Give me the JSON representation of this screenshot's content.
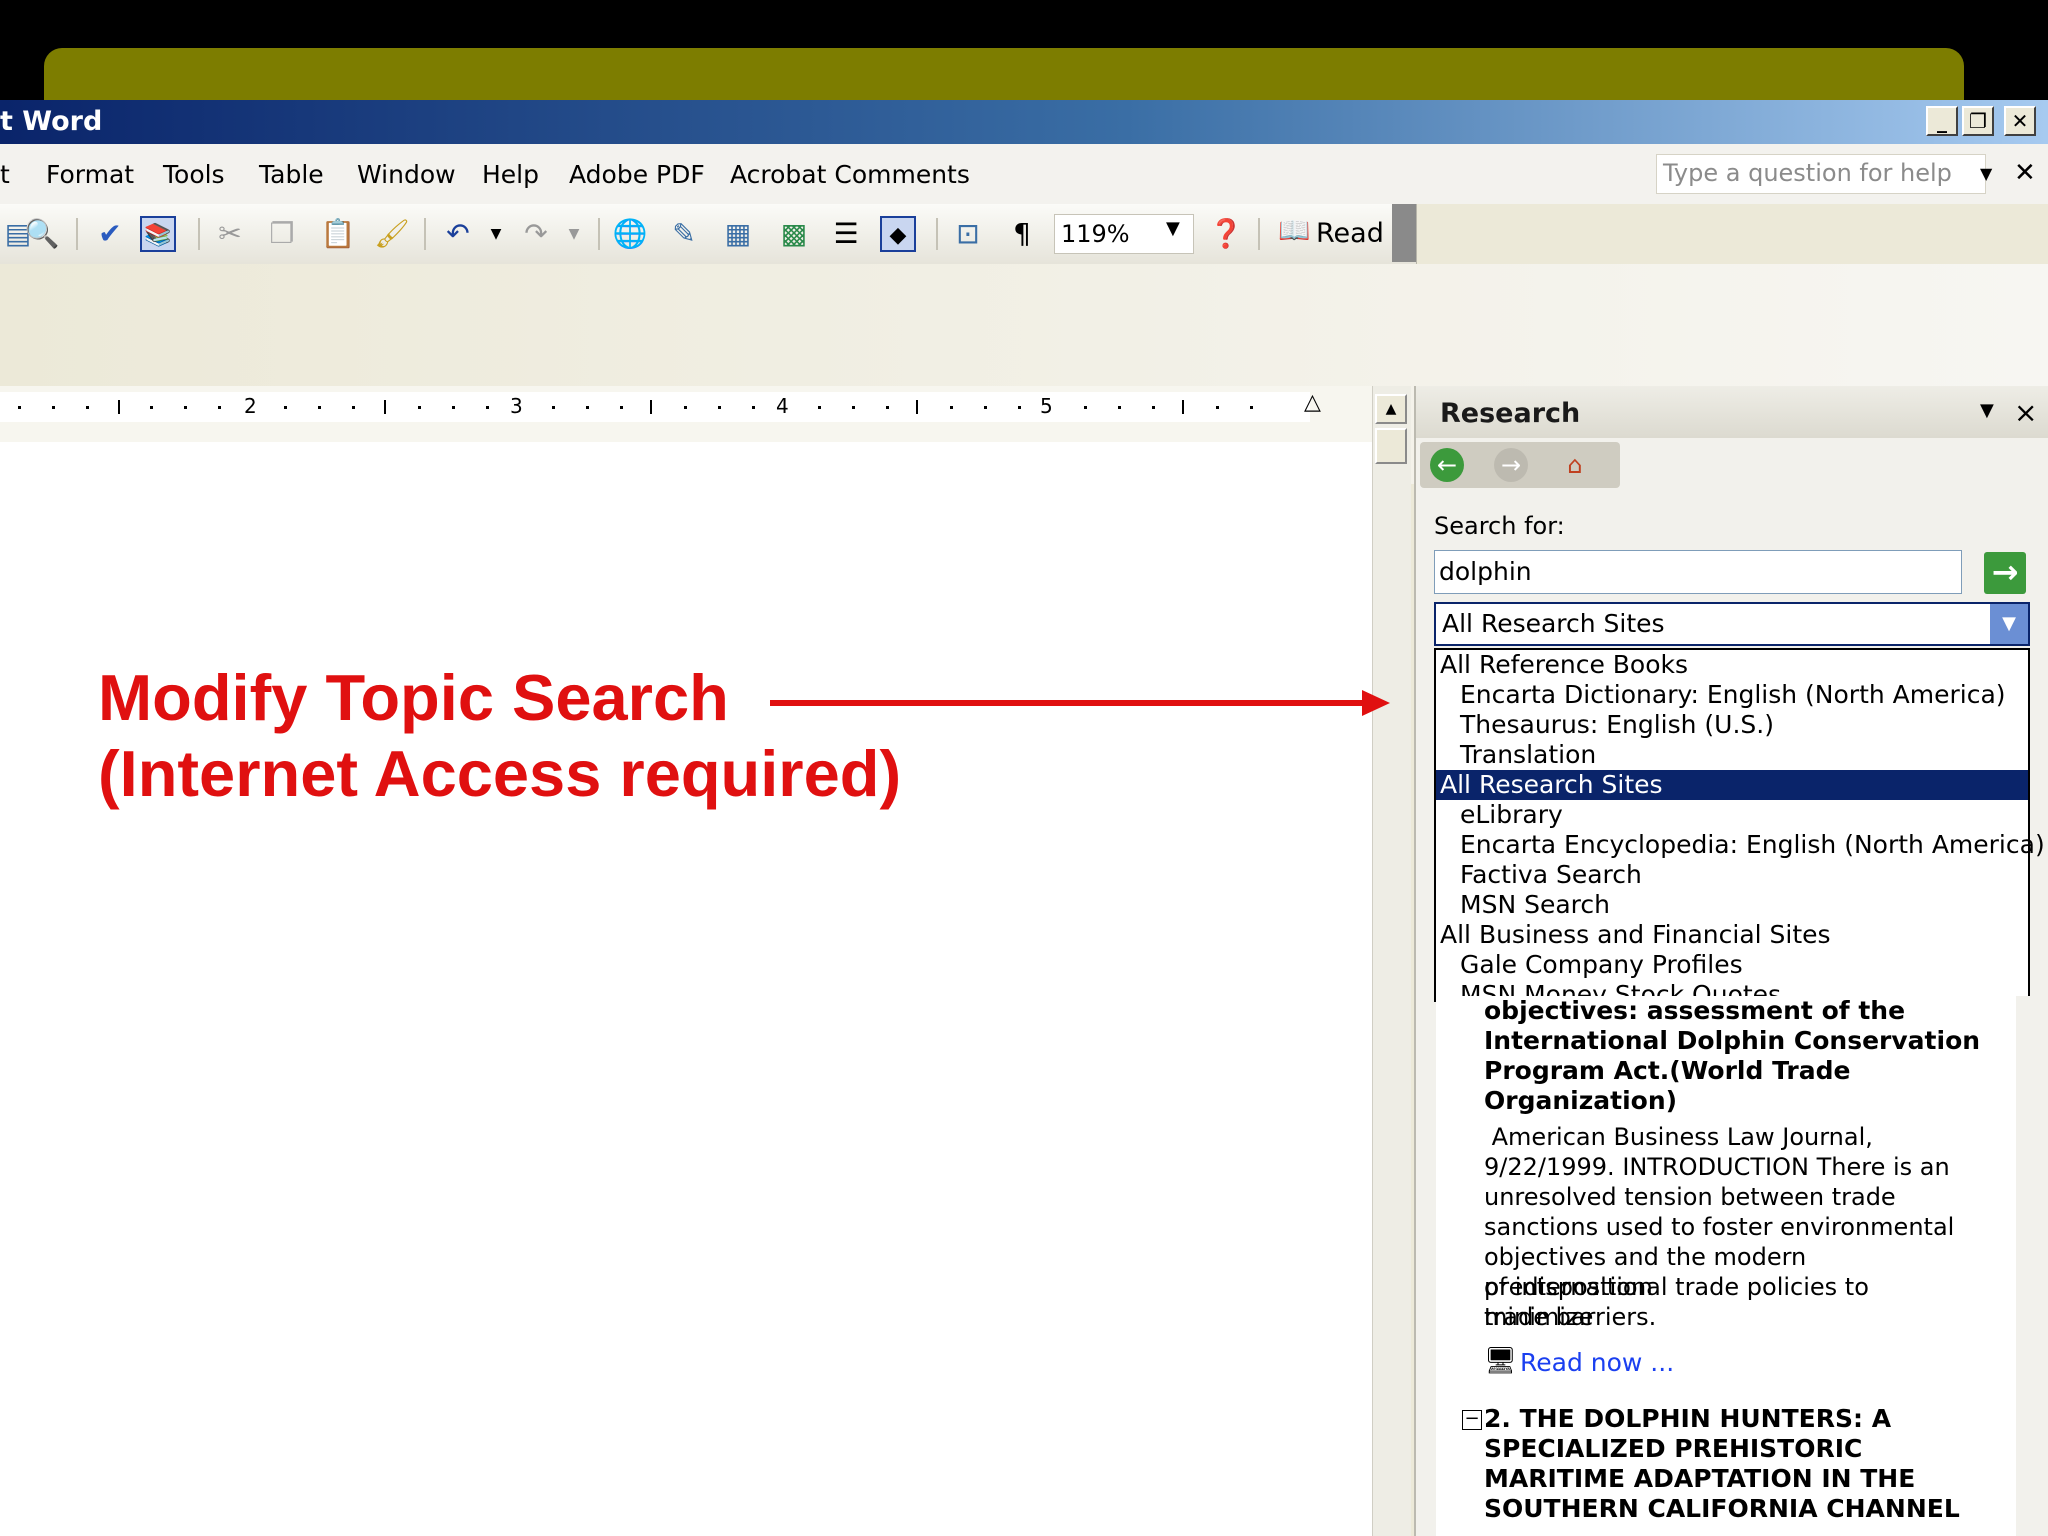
{
  "window": {
    "title": "t Word",
    "controls": {
      "minimize": "_",
      "restore": "❐",
      "close": "✕"
    }
  },
  "menubar": {
    "items": [
      "t",
      "Format",
      "Tools",
      "Table",
      "Window",
      "Help",
      "Adobe PDF",
      "Acrobat Comments"
    ],
    "help_placeholder": "Type a question for help",
    "close": "✕"
  },
  "toolbar": {
    "zoom": "119%",
    "read_label": "Read",
    "icons": [
      "print-preview-icon",
      "spelling-icon",
      "research-icon",
      "cut-icon",
      "copy-icon",
      "paste-icon",
      "format-painter-icon",
      "undo-icon",
      "redo-icon",
      "hyperlink-icon",
      "tables-borders-icon",
      "insert-table-icon",
      "insert-excel-icon",
      "columns-icon",
      "drawing-icon",
      "document-map-icon",
      "show-formatting-icon",
      "help-icon",
      "read-icon"
    ]
  },
  "ruler": {
    "numbers": [
      "2",
      "3",
      "4",
      "5"
    ]
  },
  "callout": {
    "line1": "Modify Topic Search",
    "line2": "(Internet Access required)",
    "color": "#e01010"
  },
  "research_pane": {
    "title": "Research",
    "search_label": "Search for:",
    "search_value": "dolphin",
    "selected_source": "All Research Sites",
    "options": [
      {
        "label": "All Reference Books",
        "level": "group"
      },
      {
        "label": "Encarta Dictionary: English (North America)",
        "level": "sub"
      },
      {
        "label": "Thesaurus: English (U.S.)",
        "level": "sub"
      },
      {
        "label": "Translation",
        "level": "sub"
      },
      {
        "label": "All Research Sites",
        "level": "group",
        "selected": true
      },
      {
        "label": "eLibrary",
        "level": "sub"
      },
      {
        "label": "Encarta Encyclopedia: English (North America)",
        "level": "sub"
      },
      {
        "label": "Factiva Search",
        "level": "sub"
      },
      {
        "label": "MSN Search",
        "level": "sub"
      },
      {
        "label": "All Business and Financial Sites",
        "level": "group"
      },
      {
        "label": "Gale Company Profiles",
        "level": "sub"
      },
      {
        "label": "MSN Money Stock Quotes",
        "level": "sub"
      }
    ],
    "result1": {
      "title_lines": [
        "objectives: assessment of the",
        "International Dolphin Conservation",
        "Program Act.(World Trade",
        "Organization)"
      ],
      "body_lines": [
        " American Business Law Journal,",
        "9/22/1999. INTRODUCTION There is an",
        "unresolved tension between trade",
        "sanctions used to foster environmental",
        "objectives and the modern predisposition",
        "of international trade policies to minimize",
        "trade barriers."
      ],
      "read_now": "Read now ..."
    },
    "result2": {
      "title_lines": [
        "2. THE DOLPHIN HUNTERS: A",
        "SPECIALIZED PREHISTORIC",
        "MARITIME ADAPTATION IN THE",
        "SOUTHERN CALIFORNIA CHANNEL"
      ],
      "collapse": "−"
    }
  }
}
